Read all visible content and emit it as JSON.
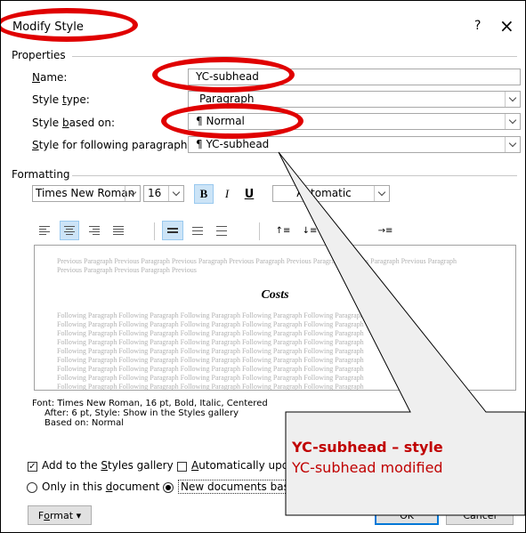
{
  "dialog": {
    "title": "Modify Style",
    "help_label": "?",
    "close_label": "×"
  },
  "properties": {
    "group_label": "Properties",
    "name": {
      "label_u": "N",
      "label_rest": "ame:",
      "value": "YC-subhead"
    },
    "style_type": {
      "label_a": "Style ",
      "label_u": "t",
      "label_b": "ype:",
      "value": "Paragraph"
    },
    "based_on": {
      "label_a": "Style ",
      "label_u": "b",
      "label_b": "ased on:",
      "value": "Normal",
      "icon": "pilcrow-icon"
    },
    "following": {
      "label_u": "S",
      "label_rest": "tyle for following paragraph:",
      "value": "YC-subhead",
      "icon": "pilcrow-icon"
    }
  },
  "formatting": {
    "group_label": "Formatting",
    "font": "Times New Roman",
    "size": "16",
    "bold": "B",
    "italic": "I",
    "underline": "U",
    "color": "Automatic"
  },
  "preview": {
    "previous_text": "Previous Paragraph Previous Paragraph Previous Paragraph Previous Paragraph Previous Paragraph Previous Paragraph Previous Paragraph Previous Paragraph Previous Paragraph Previous",
    "sample": "Costs",
    "following_text": "Following Paragraph Following Paragraph Following Paragraph Following Paragraph Following Paragraph"
  },
  "description": {
    "line1": "Font: Times New Roman, 16 pt, Bold, Italic, Centered",
    "line2": "After: 6 pt, Style: Show in the Styles gallery",
    "line3": "Based on: Normal"
  },
  "options": {
    "add_gallery": {
      "a": "Add to the ",
      "u": "S",
      "b": "tyles gallery",
      "checked": true
    },
    "auto_update": {
      "u": "A",
      "b": "utomatically update",
      "checked": false
    },
    "only_doc": {
      "a": "Only in this ",
      "u": "d",
      "b": "ocument"
    },
    "new_docs": {
      "label": "New documents based on this template"
    }
  },
  "buttons": {
    "format_u": "o",
    "format_a": "F",
    "format_b": "rmat",
    "format_arrow": "▾",
    "ok": "OK",
    "cancel": "Cancel"
  },
  "callout": {
    "title": "YC-subhead – style",
    "body": "YC-subhead modified"
  },
  "colors": {
    "annotation": "#e00000",
    "selection": "#cce4f7"
  }
}
